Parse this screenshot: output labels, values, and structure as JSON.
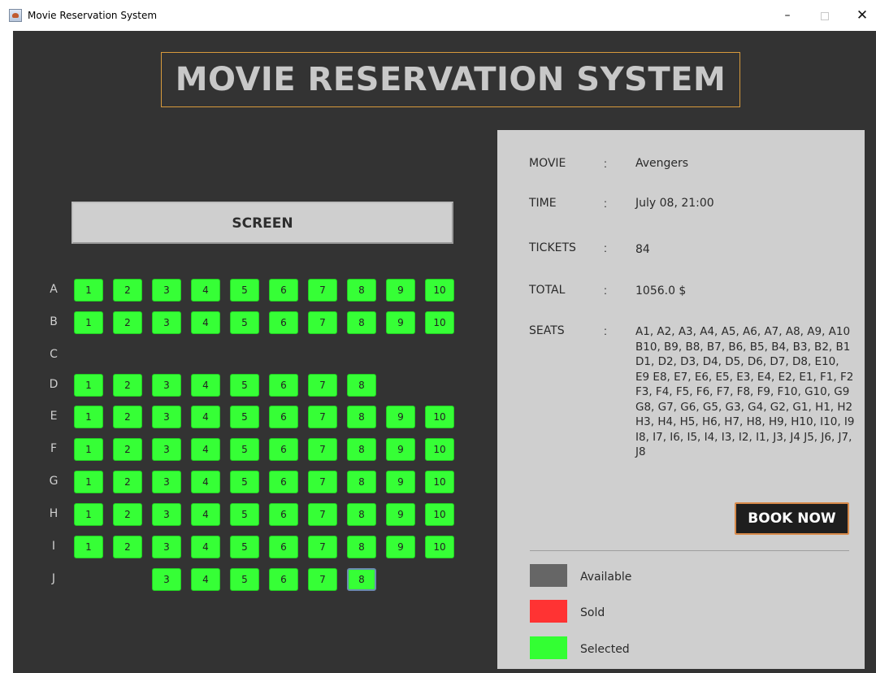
{
  "window": {
    "title": "Movie Reservation System",
    "minimize": "–",
    "close": "✕"
  },
  "app_title": "MOVIE RESERVATION SYSTEM",
  "screen_label": "SCREEN",
  "rows": [
    {
      "label": "A",
      "seats": [
        "1",
        "2",
        "3",
        "4",
        "5",
        "6",
        "7",
        "8",
        "9",
        "10"
      ]
    },
    {
      "label": "B",
      "seats": [
        "1",
        "2",
        "3",
        "4",
        "5",
        "6",
        "7",
        "8",
        "9",
        "10"
      ]
    },
    {
      "label": "C",
      "seats": []
    },
    {
      "label": "D",
      "seats": [
        "1",
        "2",
        "3",
        "4",
        "5",
        "6",
        "7",
        "8"
      ]
    },
    {
      "label": "E",
      "seats": [
        "1",
        "2",
        "3",
        "4",
        "5",
        "6",
        "7",
        "8",
        "9",
        "10"
      ]
    },
    {
      "label": "F",
      "seats": [
        "1",
        "2",
        "3",
        "4",
        "5",
        "6",
        "7",
        "8",
        "9",
        "10"
      ]
    },
    {
      "label": "G",
      "seats": [
        "1",
        "2",
        "3",
        "4",
        "5",
        "6",
        "7",
        "8",
        "9",
        "10"
      ]
    },
    {
      "label": "H",
      "seats": [
        "1",
        "2",
        "3",
        "4",
        "5",
        "6",
        "7",
        "8",
        "9",
        "10"
      ]
    },
    {
      "label": "I",
      "seats": [
        "1",
        "2",
        "3",
        "4",
        "5",
        "6",
        "7",
        "8",
        "9",
        "10"
      ]
    },
    {
      "label": "J",
      "seats": [
        "3",
        "4",
        "5",
        "6",
        "7",
        "8"
      ]
    }
  ],
  "info": {
    "movie_key": "MOVIE",
    "movie": "Avengers",
    "time_key": "TIME",
    "time": "July 08, 21:00",
    "tickets_key": "TICKETS",
    "tickets": "84",
    "total_key": "TOTAL",
    "total": "1056.0 $",
    "seats_key": "SEATS",
    "colon": ":",
    "seats": "A1, A2, A3, A4, A5, A6, A7, A8, A9, A10 B10, B9, B8, B7, B6, B5, B4, B3, B2, B1 D1, D2, D3, D4, D5, D6, D7, D8, E10, E9 E8, E7, E6, E5, E3, E4, E2, E1, F1, F2 F3, F4, F5, F6, F7, F8, F9, F10, G10, G9 G8, G7, G6, G5, G3, G4, G2, G1, H1, H2 H3, H4, H5, H6, H7, H8, H9, H10, I10, I9 I8, I7, I6, I5, I4, I3, I2, I1, J3, J4 J5, J6, J7, J8"
  },
  "book_button": "BOOK NOW",
  "legend": [
    {
      "label": "Available",
      "color": "#666666"
    },
    {
      "label": "Sold",
      "color": "#ff3333"
    },
    {
      "label": "Selected",
      "color": "#33ff33"
    }
  ],
  "colors": {
    "background": "#333333",
    "panel": "#cfcfcf",
    "seat_selected": "#36ff36",
    "title_border": "#d79a3c",
    "button_border": "#d88a4a"
  }
}
